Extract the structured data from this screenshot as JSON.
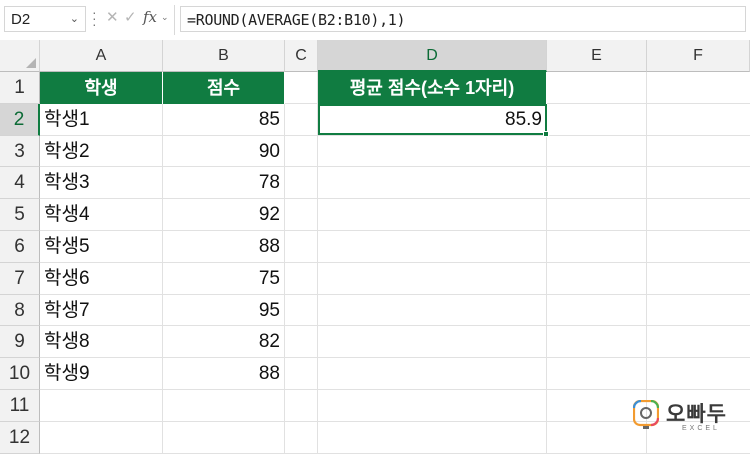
{
  "formula_bar": {
    "name_box": "D2",
    "formula": "=ROUND(AVERAGE(B2:B10),1)",
    "fx_label": "fx"
  },
  "columns": [
    "A",
    "B",
    "C",
    "D",
    "E",
    "F"
  ],
  "selected_column": "D",
  "rows": [
    "1",
    "2",
    "3",
    "4",
    "5",
    "6",
    "7",
    "8",
    "9",
    "10",
    "11",
    "12"
  ],
  "selected_row": "2",
  "headers": {
    "A1": "학생",
    "B1": "점수",
    "D1": "평균 점수(소수 1자리)"
  },
  "table": [
    {
      "name": "학생1",
      "score": "85"
    },
    {
      "name": "학생2",
      "score": "90"
    },
    {
      "name": "학생3",
      "score": "78"
    },
    {
      "name": "학생4",
      "score": "92"
    },
    {
      "name": "학생5",
      "score": "88"
    },
    {
      "name": "학생6",
      "score": "75"
    },
    {
      "name": "학생7",
      "score": "95"
    },
    {
      "name": "학생8",
      "score": "82"
    },
    {
      "name": "학생9",
      "score": "88"
    }
  ],
  "result": {
    "D2": "85.9"
  },
  "watermark": {
    "brand": "오빠두",
    "sub": "EXCEL"
  },
  "colors": {
    "header_green": "#107c41",
    "selection_green": "#107c41"
  }
}
